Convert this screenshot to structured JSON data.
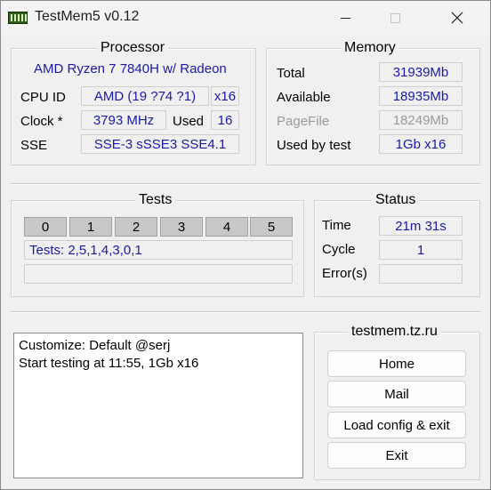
{
  "window": {
    "title": "TestMem5 v0.12",
    "icon": "memory-chip-icon",
    "controls": [
      "minimize-icon",
      "maximize-icon",
      "close-icon"
    ]
  },
  "processor": {
    "title": "Processor",
    "name": "AMD Ryzen 7 7840H w/ Radeon",
    "cpu_id_label": "CPU ID",
    "cpu_id_value": "AMD  (19 ?74 ?1)",
    "threads": "x16",
    "clock_label": "Clock *",
    "clock_value": "3793 MHz",
    "used_label": "Used",
    "used_value": "16",
    "sse_label": "SSE",
    "sse_value": "SSE-3 sSSE3 SSE4.1"
  },
  "memory": {
    "title": "Memory",
    "total_label": "Total",
    "total_value": "31939Mb",
    "available_label": "Available",
    "available_value": "18935Mb",
    "pagefile_label": "PageFile",
    "pagefile_value": "18249Mb",
    "used_by_test_label": "Used by test",
    "used_by_test_value": "1Gb x16"
  },
  "tests": {
    "title": "Tests",
    "cells": [
      "0",
      "1",
      "2",
      "3",
      "4",
      "5"
    ],
    "sequence": "Tests: 2,5,1,4,3,0,1",
    "extra": ""
  },
  "status": {
    "title": "Status",
    "time_label": "Time",
    "time_value": "21m 31s",
    "cycle_label": "Cycle",
    "cycle_value": "1",
    "errors_label": "Error(s)",
    "errors_value": ""
  },
  "log": {
    "lines": [
      "Customize: Default @serj",
      "Start testing at 11:55, 1Gb x16"
    ]
  },
  "links": {
    "title": "testmem.tz.ru",
    "home": "Home",
    "mail": "Mail",
    "load_config": "Load config & exit",
    "exit": "Exit"
  }
}
